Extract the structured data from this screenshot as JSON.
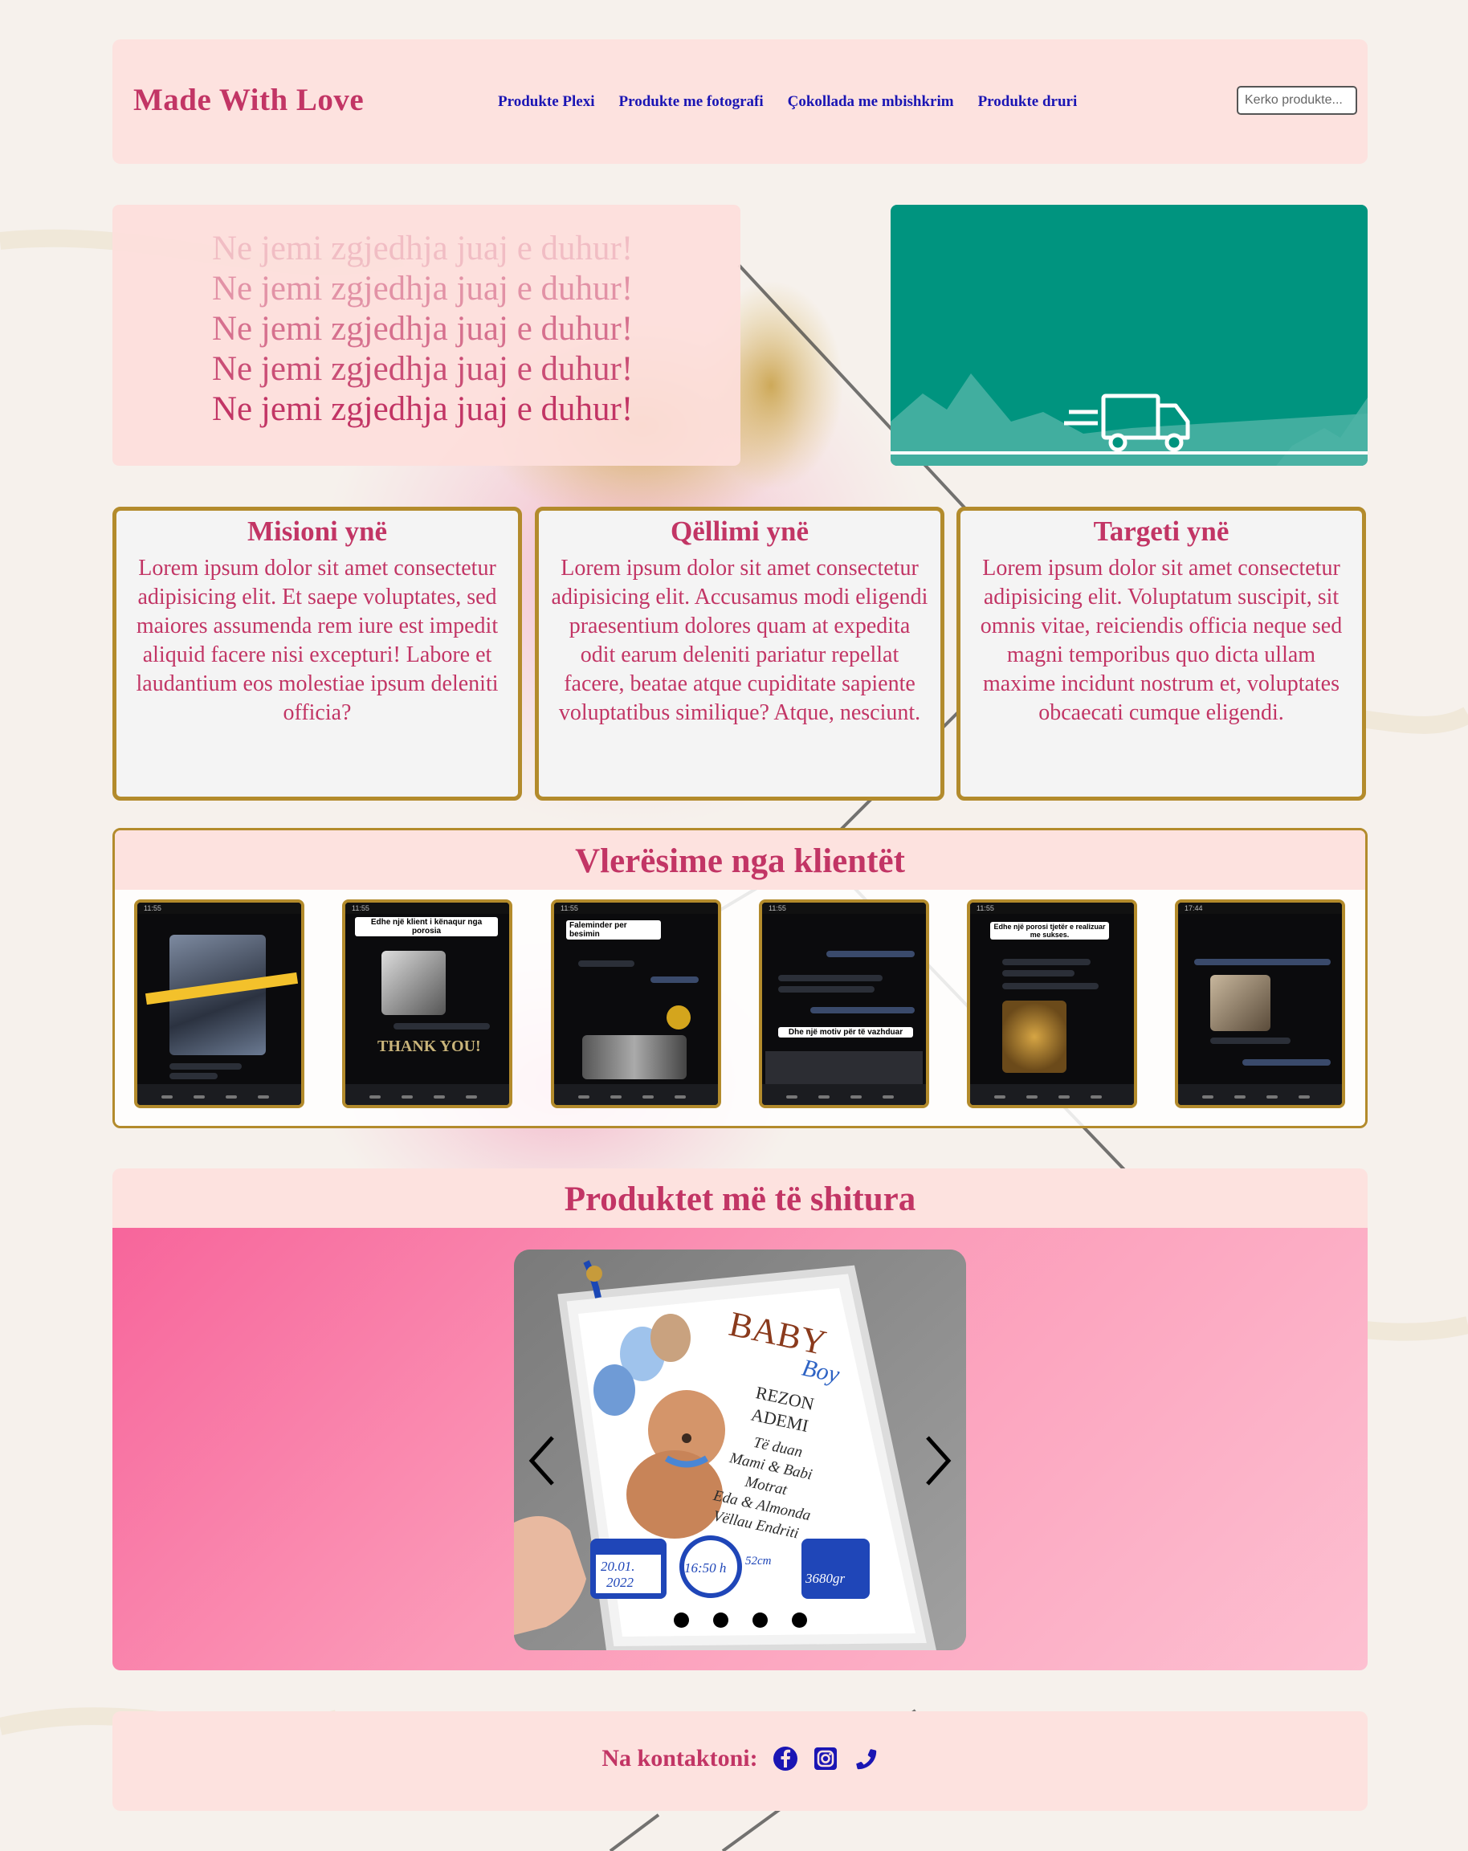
{
  "brand": {
    "name": "Made With Love",
    "color": "#c23565"
  },
  "nav": [
    {
      "label": "Produkte Plexi"
    },
    {
      "label": "Produkte me fotografi"
    },
    {
      "label": "Çokollada me mbishkrim"
    },
    {
      "label": "Produkte druri"
    }
  ],
  "search": {
    "placeholder": "Kerko produkte..."
  },
  "hero": {
    "lines": [
      "Ne jemi zgjedhja juaj e duhur!",
      "Ne jemi zgjedhja juaj e duhur!",
      "Ne jemi zgjedhja juaj e duhur!",
      "Ne jemi zgjedhja juaj e duhur!",
      "Ne jemi zgjedhja juaj e duhur!"
    ],
    "banner_icon": "delivery-truck-icon",
    "banner_color": "#00947f"
  },
  "cards": [
    {
      "title": "Misioni ynë",
      "text": "Lorem ipsum dolor sit amet consectetur adipisicing elit. Et saepe voluptates, sed maiores assumenda rem iure est impedit aliquid facere nisi excepturi! Labore et laudantium eos molestiae ipsum deleniti officia?"
    },
    {
      "title": "Qëllimi ynë",
      "text": "Lorem ipsum dolor sit amet consectetur adipisicing elit. Accusamus modi eligendi praesentium dolores quam at expedita odit earum deleniti pariatur repellat facere, beatae atque cupiditate sapiente voluptatibus similique? Atque, nesciunt."
    },
    {
      "title": "Targeti ynë",
      "text": "Lorem ipsum dolor sit amet consectetur adipisicing elit. Voluptatum suscipit, sit omnis vitae, reiciendis officia neque sed magni temporibus quo dicta ullam maxime incidunt nostrum et, voluptates obcaecati cumque eligendi."
    }
  ],
  "reviews": {
    "title": "Vlerësime nga klientët",
    "shots": [
      {
        "time": "11:55",
        "sticker": ""
      },
      {
        "time": "11:55",
        "sticker": "Edhe një klient i kënaqur nga porosia"
      },
      {
        "time": "11:55",
        "sticker": "Faleminder per besimin"
      },
      {
        "time": "11:55",
        "sticker": "Dhe një motiv për të vazhduar"
      },
      {
        "time": "11:55",
        "sticker": "Edhe një porosi tjetër e realizuar me sukses."
      },
      {
        "time": "17:44",
        "sticker": ""
      }
    ]
  },
  "best_sellers": {
    "title": "Produktet më të shitura",
    "slides": 4,
    "active_slide": 1,
    "product": {
      "line1": "BABY",
      "line2": "Boy",
      "names": [
        "REZON",
        "ADEMI",
        "Të duan",
        "Mami & Babi",
        "Motrat",
        "Eda & Almonda",
        "Vëllau Endriti"
      ],
      "date": [
        "20.01.",
        "2022"
      ],
      "time": "16:50 h",
      "length": "52cm",
      "weight": "3680gr"
    }
  },
  "footer": {
    "contact_label": "Na kontaktoni:",
    "icons": [
      "facebook-icon",
      "instagram-icon",
      "phone-icon"
    ],
    "icon_color": "#1a15b4"
  }
}
